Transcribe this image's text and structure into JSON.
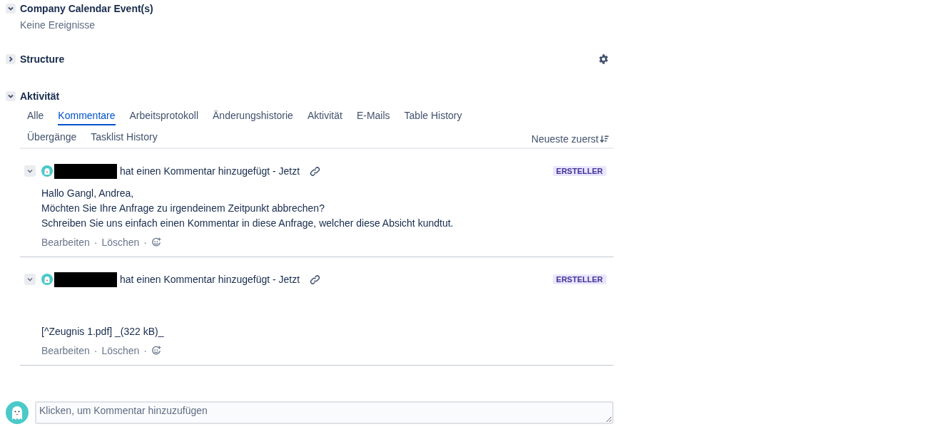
{
  "sections": [
    {
      "title": "Company Calendar Event(s)",
      "expanded": true,
      "empty_text": "Keine Ereignisse"
    },
    {
      "title": "Structure",
      "expanded": false,
      "settings": true
    }
  ],
  "activity": {
    "title": "Aktivität",
    "expanded": true,
    "tabs": [
      {
        "label": "Alle",
        "selected": false
      },
      {
        "label": "Kommentare",
        "selected": true
      },
      {
        "label": "Arbeitsprotokoll",
        "selected": false
      },
      {
        "label": "Änderungshistorie",
        "selected": false
      },
      {
        "label": "Aktivität",
        "selected": false
      },
      {
        "label": "E-Mails",
        "selected": false
      },
      {
        "label": "Table History",
        "selected": false
      },
      {
        "label": "Übergänge",
        "selected": false
      },
      {
        "label": "Tasklist History",
        "selected": false
      }
    ],
    "sort": "Neueste zuerst",
    "comments": [
      {
        "expanded": true,
        "action": "hat einen Kommentar hinzugefügt - Jetzt",
        "badge": "ERSTELLER",
        "kind": "text",
        "lines": [
          "Hallo Gangl, Andrea,",
          "Möchten Sie Ihre Anfrage zu irgendeinem Zeitpunkt abbrechen?",
          "Schreiben Sie uns einfach einen Kommentar in diese Anfrage, welcher diese Absicht kundtut."
        ],
        "actions": [
          "Bearbeiten",
          "Löschen"
        ],
        "separators": [
          "·",
          "·"
        ]
      },
      {
        "expanded": true,
        "action": "hat einen Kommentar hinzugefügt - Jetzt",
        "badge": "ERSTELLER",
        "kind": "attachment",
        "lines": [
          "[^Zeugnis 1.pdf] _(322 kB)_"
        ],
        "actions": [
          "Bearbeiten",
          "Löschen"
        ],
        "separators": [
          "·",
          "·"
        ]
      }
    ],
    "new_comment": {
      "placeholder": "Klicken, um Kommentar hinzuzufügen"
    }
  }
}
